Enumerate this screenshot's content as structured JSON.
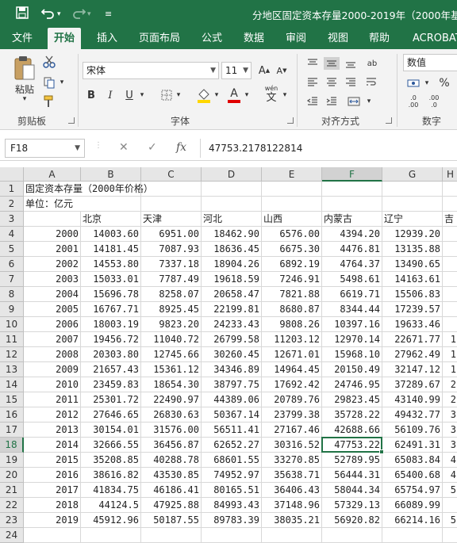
{
  "window": {
    "title": "分地区固定资本存量2000-2019年（2000年基期",
    "save_icon": "save-icon",
    "undo_icon": "undo-icon",
    "redo_icon": "redo-icon",
    "customize_icon": "customize-quick-access-icon"
  },
  "ribbon_tabs": [
    {
      "label": "文件"
    },
    {
      "label": "开始"
    },
    {
      "label": "插入"
    },
    {
      "label": "页面布局"
    },
    {
      "label": "公式"
    },
    {
      "label": "数据"
    },
    {
      "label": "审阅"
    },
    {
      "label": "视图"
    },
    {
      "label": "帮助"
    },
    {
      "label": "ACROBAT"
    }
  ],
  "ribbon": {
    "paste_label": "粘贴",
    "clipboard_label": "剪贴板",
    "font_name": "宋体",
    "font_size": "11",
    "font_label": "字体",
    "bold": "B",
    "italic": "I",
    "underline": "U",
    "grow_font": "A",
    "shrink_font": "A",
    "wen": "wén",
    "wen_char": "文",
    "align_label": "对齐方式",
    "number_format": "数值",
    "number_label": "数字",
    "percent": "%",
    "inc_dec": ".0 .00",
    "dec_dec": ".00 .0",
    "ab": "ab",
    "accent_colors": {
      "green": "#217346",
      "font_red": "#e00000",
      "highlight_yellow": "#ffd700"
    }
  },
  "formula_bar": {
    "name_box": "F18",
    "fx": "fx",
    "formula": "47753.2178122814"
  },
  "columns": [
    "A",
    "B",
    "C",
    "D",
    "E",
    "F",
    "G",
    "H"
  ],
  "rows": [
    {
      "n": "1",
      "a": "固定资本存量（2000年价格）",
      "b": "",
      "c": "",
      "d": "",
      "e": "",
      "f": "",
      "g": "",
      "h": ""
    },
    {
      "n": "2",
      "a": "单位：亿元",
      "b": "",
      "c": "",
      "d": "",
      "e": "",
      "f": "",
      "g": "",
      "h": ""
    },
    {
      "n": "3",
      "a": "",
      "b": "北京",
      "c": "天津",
      "d": "河北",
      "e": "山西",
      "f": "内蒙古",
      "g": "辽宁",
      "h": "吉"
    },
    {
      "n": "4",
      "a": "2000",
      "b": "14003.60",
      "c": "6951.00",
      "d": "18462.90",
      "e": "6576.00",
      "f": "4394.20",
      "g": "12939.20",
      "h": ""
    },
    {
      "n": "5",
      "a": "2001",
      "b": "14181.45",
      "c": "7087.93",
      "d": "18636.45",
      "e": "6675.30",
      "f": "4476.81",
      "g": "13135.88",
      "h": ""
    },
    {
      "n": "6",
      "a": "2002",
      "b": "14553.80",
      "c": "7337.18",
      "d": "18904.26",
      "e": "6892.19",
      "f": "4764.37",
      "g": "13490.65",
      "h": ""
    },
    {
      "n": "7",
      "a": "2003",
      "b": "15033.01",
      "c": "7787.49",
      "d": "19618.59",
      "e": "7246.91",
      "f": "5498.61",
      "g": "14163.61",
      "h": ""
    },
    {
      "n": "8",
      "a": "2004",
      "b": "15696.78",
      "c": "8258.07",
      "d": "20658.47",
      "e": "7821.88",
      "f": "6619.71",
      "g": "15506.83",
      "h": ""
    },
    {
      "n": "9",
      "a": "2005",
      "b": "16767.71",
      "c": "8925.45",
      "d": "22199.81",
      "e": "8680.87",
      "f": "8344.44",
      "g": "17239.57",
      "h": ""
    },
    {
      "n": "10",
      "a": "2006",
      "b": "18003.19",
      "c": "9823.20",
      "d": "24233.43",
      "e": "9808.26",
      "f": "10397.16",
      "g": "19633.46",
      "h": ""
    },
    {
      "n": "11",
      "a": "2007",
      "b": "19456.72",
      "c": "11040.72",
      "d": "26799.58",
      "e": "11203.12",
      "f": "12970.14",
      "g": "22671.77",
      "h": "1"
    },
    {
      "n": "12",
      "a": "2008",
      "b": "20303.80",
      "c": "12745.66",
      "d": "30260.45",
      "e": "12671.01",
      "f": "15968.10",
      "g": "27962.49",
      "h": "1"
    },
    {
      "n": "13",
      "a": "2009",
      "b": "21657.43",
      "c": "15361.12",
      "d": "34346.89",
      "e": "14964.45",
      "f": "20150.49",
      "g": "32147.12",
      "h": "1"
    },
    {
      "n": "14",
      "a": "2010",
      "b": "23459.83",
      "c": "18654.30",
      "d": "38797.75",
      "e": "17692.42",
      "f": "24746.95",
      "g": "37289.67",
      "h": "2"
    },
    {
      "n": "15",
      "a": "2011",
      "b": "25301.72",
      "c": "22490.97",
      "d": "44389.06",
      "e": "20789.76",
      "f": "29823.45",
      "g": "43140.99",
      "h": "2"
    },
    {
      "n": "16",
      "a": "2012",
      "b": "27646.65",
      "c": "26830.63",
      "d": "50367.14",
      "e": "23799.38",
      "f": "35728.22",
      "g": "49432.77",
      "h": "3"
    },
    {
      "n": "17",
      "a": "2013",
      "b": "30154.01",
      "c": "31576.00",
      "d": "56511.41",
      "e": "27167.46",
      "f": "42688.66",
      "g": "56109.76",
      "h": "3"
    },
    {
      "n": "18",
      "a": "2014",
      "b": "32666.55",
      "c": "36456.87",
      "d": "62652.27",
      "e": "30316.52",
      "f": "47753.22",
      "g": "62491.31",
      "h": "3"
    },
    {
      "n": "19",
      "a": "2015",
      "b": "35208.85",
      "c": "40288.78",
      "d": "68601.55",
      "e": "33270.85",
      "f": "52789.95",
      "g": "65083.84",
      "h": "4"
    },
    {
      "n": "20",
      "a": "2016",
      "b": "38616.82",
      "c": "43530.85",
      "d": "74952.97",
      "e": "35638.71",
      "f": "56444.31",
      "g": "65400.68",
      "h": "4"
    },
    {
      "n": "21",
      "a": "2017",
      "b": "41834.75",
      "c": "46186.41",
      "d": "80165.51",
      "e": "36406.43",
      "f": "58044.34",
      "g": "65754.97",
      "h": "5"
    },
    {
      "n": "22",
      "a": "2018",
      "b": "44124.5",
      "c": "47925.88",
      "d": "84993.43",
      "e": "37148.96",
      "f": "57329.13",
      "g": "66089.99",
      "h": ""
    },
    {
      "n": "23",
      "a": "2019",
      "b": "45912.96",
      "c": "50187.55",
      "d": "89783.39",
      "e": "38035.21",
      "f": "56920.82",
      "g": "66214.16",
      "h": "5"
    },
    {
      "n": "24",
      "a": "",
      "b": "",
      "c": "",
      "d": "",
      "e": "",
      "f": "",
      "g": "",
      "h": ""
    }
  ]
}
